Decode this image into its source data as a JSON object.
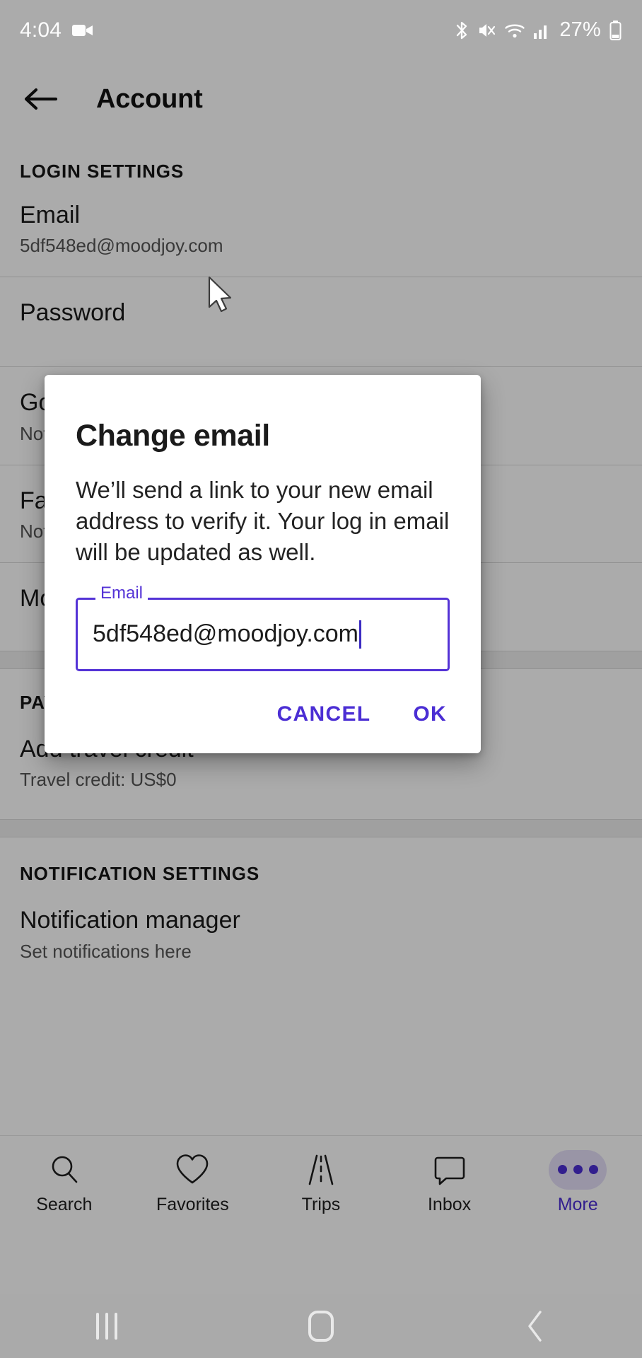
{
  "status_bar": {
    "time": "4:04",
    "battery_percent": "27%",
    "icons": [
      "video-camera-icon",
      "bluetooth-icon",
      "mute-icon",
      "wifi-icon",
      "cellular-signal-icon",
      "battery-icon"
    ]
  },
  "app_bar": {
    "back_label": "back-arrow",
    "title": "Account"
  },
  "sections": [
    {
      "header": "LOGIN SETTINGS",
      "rows": [
        {
          "title": "Email",
          "sub": "5df548ed@moodjoy.com"
        },
        {
          "title": "Password",
          "sub": ""
        },
        {
          "title": "Google",
          "sub": "Not connected"
        },
        {
          "title": "Facebook",
          "sub": "Not connected"
        },
        {
          "title": "Mobile number",
          "sub": ""
        }
      ]
    },
    {
      "header": "PAYMENT SETTINGS",
      "rows": [
        {
          "title": "Add travel credit",
          "sub": "Travel credit: US$0"
        }
      ]
    },
    {
      "header": "NOTIFICATION SETTINGS",
      "rows": [
        {
          "title": "Notification manager",
          "sub": "Set notifications here"
        }
      ]
    }
  ],
  "dialog": {
    "title": "Change email",
    "body": "We’ll send a link to your new email address to verify it. Your log in email will be updated as well.",
    "field": {
      "label": "Email",
      "value": "5df548ed@moodjoy.com",
      "placeholder": "Email"
    },
    "cancel_label": "CANCEL",
    "ok_label": "OK"
  },
  "bottom_nav": {
    "items": [
      {
        "label": "Search",
        "icon": "search-icon",
        "active": false
      },
      {
        "label": "Favorites",
        "icon": "heart-icon",
        "active": false
      },
      {
        "label": "Trips",
        "icon": "road-icon",
        "active": false
      },
      {
        "label": "Inbox",
        "icon": "chat-bubble-icon",
        "active": false
      },
      {
        "label": "More",
        "icon": "ellipsis-icon",
        "active": true
      }
    ]
  },
  "android_nav": {
    "recents": "recents-button",
    "home": "home-button",
    "back": "back-button"
  },
  "colors": {
    "accent": "#4b2ed4",
    "field_outline": "#5433d6",
    "scrim": "rgba(0,0,0,0.33)",
    "nav_bar": "#aaaaaa"
  }
}
